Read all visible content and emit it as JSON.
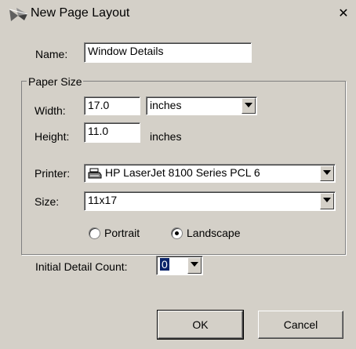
{
  "window": {
    "title": "New Page Layout",
    "close_symbol": "✕"
  },
  "name": {
    "label": "Name:",
    "value": "Window Details"
  },
  "paper_size": {
    "legend": "Paper Size",
    "width_label": "Width:",
    "width_value": "17.0",
    "width_unit": "inches",
    "height_label": "Height:",
    "height_value": "11.0",
    "height_unit": "inches",
    "printer_label": "Printer:",
    "printer_value": "HP LaserJet 8100 Series PCL 6",
    "size_label": "Size:",
    "size_value": "11x17",
    "orientation": {
      "portrait_label": "Portrait",
      "landscape_label": "Landscape",
      "selected": "Landscape"
    }
  },
  "detail_count": {
    "label": "Initial Detail Count:",
    "value": "0"
  },
  "buttons": {
    "ok": "OK",
    "cancel": "Cancel"
  },
  "icons": {
    "title": "layout-icon",
    "printer": "printer-icon",
    "close": "close-icon"
  }
}
